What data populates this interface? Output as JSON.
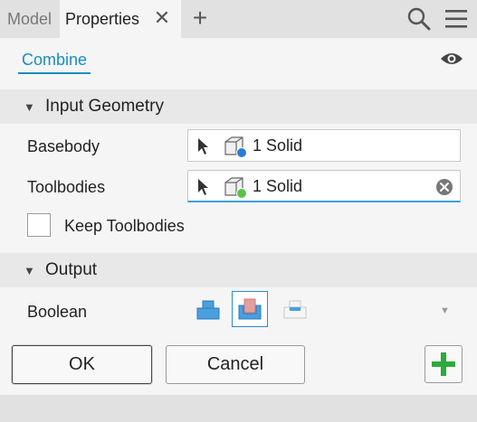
{
  "tabs": {
    "model": "Model",
    "properties": "Properties"
  },
  "header": {
    "combine": "Combine"
  },
  "sections": {
    "input": "Input Geometry",
    "output": "Output"
  },
  "fields": {
    "basebody": {
      "label": "Basebody",
      "value": "1 Solid"
    },
    "toolbodies": {
      "label": "Toolbodies",
      "value": "1 Solid"
    },
    "keep_toolbodies": {
      "label": "Keep Toolbodies",
      "checked": false
    },
    "boolean": {
      "label": "Boolean",
      "options": [
        "join-icon",
        "cut-icon",
        "intersect-icon"
      ],
      "selected": "cut-icon"
    }
  },
  "buttons": {
    "ok": "OK",
    "cancel": "Cancel"
  },
  "colors": {
    "accent": "#1a8dc1",
    "apply_green": "#2eaa3c",
    "base_dot": "#2e7bd6",
    "tool_dot": "#5cc24a"
  }
}
